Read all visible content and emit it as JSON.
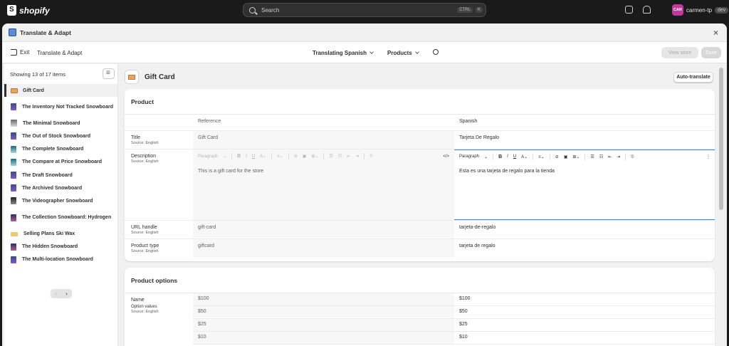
{
  "topbar": {
    "brand": "shopify",
    "search_placeholder": "Search",
    "shortcut_ctrl": "CTRL",
    "shortcut_key": "K",
    "user_initials": "CAR",
    "user_name": "carmen-tp",
    "env_tag": "dev"
  },
  "window": {
    "title": "Translate & Adapt",
    "close_label": "×"
  },
  "toolbar": {
    "exit_label": "Exit",
    "app_name": "Translate & Adapt",
    "language_selector": "Translating Spanish",
    "resource_selector": "Products",
    "view_store_label": "View store",
    "save_label": "Save"
  },
  "sidebar": {
    "summary": "Showing 13 of 17 items",
    "items": [
      {
        "label": "Gift Card",
        "thumb": "gc",
        "selected": true
      },
      {
        "label": "The Inventory Not Tracked Snowboard",
        "thumb": "t1"
      },
      {
        "label": "The Minimal Snowboard",
        "thumb": "t3"
      },
      {
        "label": "The Out of Stock Snowboard",
        "thumb": "t1"
      },
      {
        "label": "The Complete Snowboard",
        "thumb": "t2"
      },
      {
        "label": "The Compare at Price Snowboard",
        "thumb": "t2"
      },
      {
        "label": "The Draft Snowboard",
        "thumb": "t1"
      },
      {
        "label": "The Archived Snowboard",
        "thumb": "t1"
      },
      {
        "label": "The Videographer Snowboard",
        "thumb": "t5"
      },
      {
        "label": "The Collection Snowboard: Hydrogen",
        "thumb": "t4"
      },
      {
        "label": "Selling Plans Ski Wax",
        "thumb": "wax"
      },
      {
        "label": "The Hidden Snowboard",
        "thumb": "t4"
      },
      {
        "label": "The Multi-location Snowboard",
        "thumb": "t1"
      }
    ],
    "prev_label": "‹",
    "next_label": "›"
  },
  "main": {
    "page_title": "Gift Card",
    "auto_translate_label": "Auto-translate",
    "product_card": {
      "heading": "Product",
      "col_reference": "Reference",
      "col_spanish": "Spanish",
      "source_note": "Source: English",
      "title_label": "Title",
      "title_ref": "Gift Card",
      "title_es": "Tarjeta De Regalo",
      "desc_label": "Description",
      "rt_paragraph": "Paragraph",
      "desc_ref": "This is a gift card for the store",
      "desc_es": "Esta es una tarjeta de regalo para la tienda",
      "handle_label": "URL handle",
      "handle_ref": "gift-card",
      "handle_es": "tarjeta-de-regalo",
      "type_label": "Product type",
      "type_ref": "giftcard",
      "type_es": "tarjeta de regalo"
    },
    "options_card": {
      "heading": "Product options",
      "name_label": "Name",
      "option_values_label": "Option values",
      "source_note": "Source: English",
      "values_ref": [
        "$100",
        "$50",
        "$25",
        "$10"
      ],
      "values_es": [
        "$100",
        "$50",
        "$25",
        "$10"
      ]
    }
  }
}
